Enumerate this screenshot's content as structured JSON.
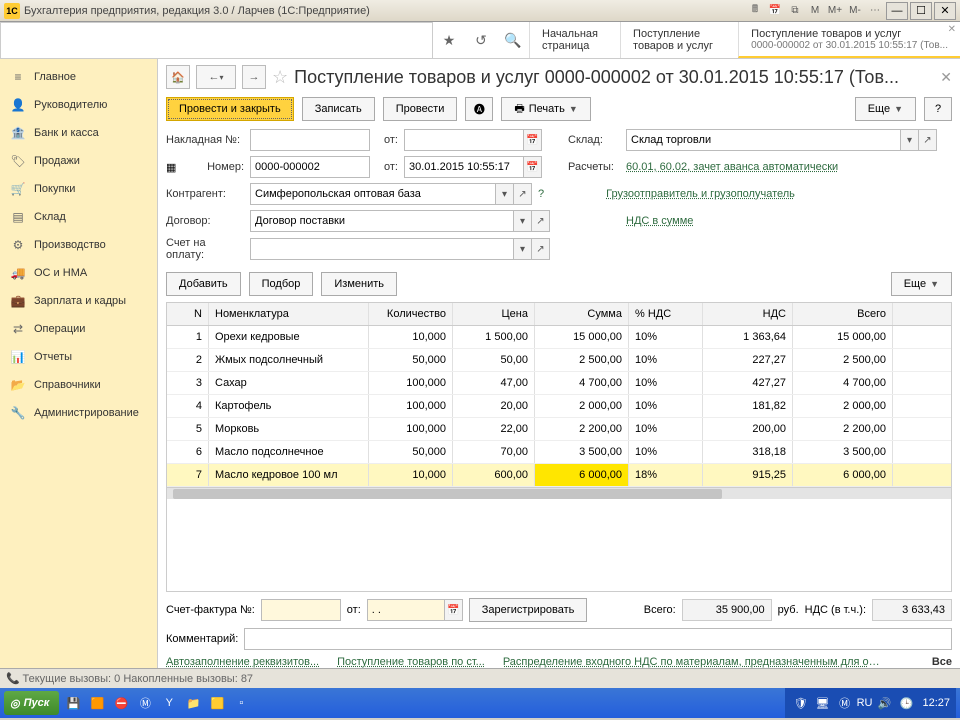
{
  "titlebar": {
    "app_icon": "1C",
    "title": "Бухгалтерия предприятия, редакция 3.0 / Ларчев  (1С:Предприятие)"
  },
  "tabs": {
    "t0": "Начальная страница",
    "t1": "Поступление товаров и услуг",
    "t2": "Поступление товаров и услуг",
    "t2_sub": "0000-000002 от 30.01.2015 10:55:17 (Тов..."
  },
  "sidebar": {
    "items": [
      {
        "icon": "≡",
        "label": "Главное"
      },
      {
        "icon": "👤",
        "label": "Руководителю"
      },
      {
        "icon": "🏦",
        "label": "Банк и касса"
      },
      {
        "icon": "🏷",
        "label": "Продажи"
      },
      {
        "icon": "🛒",
        "label": "Покупки"
      },
      {
        "icon": "▤",
        "label": "Склад"
      },
      {
        "icon": "⚙",
        "label": "Производство"
      },
      {
        "icon": "🚚",
        "label": "ОС и НМА"
      },
      {
        "icon": "💼",
        "label": "Зарплата и кадры"
      },
      {
        "icon": "⇄",
        "label": "Операции"
      },
      {
        "icon": "📊",
        "label": "Отчеты"
      },
      {
        "icon": "📂",
        "label": "Справочники"
      },
      {
        "icon": "🔧",
        "label": "Администрирование"
      }
    ]
  },
  "header": {
    "title": "Поступление товаров и услуг 0000-000002 от 30.01.2015 10:55:17 (Тов..."
  },
  "toolbar": {
    "post_close": "Провести и закрыть",
    "write": "Записать",
    "post": "Провести",
    "print": "Печать",
    "more": "Еще"
  },
  "form": {
    "nakl_label": "Накладная №:",
    "ot": "от:",
    "sklad_label": "Склад:",
    "sklad_value": "Склад торговли",
    "nomer_label": "Номер:",
    "nomer_value": "0000-000002",
    "nomer_date": "30.01.2015 10:55:17",
    "raschety_label": "Расчеты:",
    "raschety_link": "60.01, 60.02, зачет аванса автоматически",
    "kontragent_label": "Контрагент:",
    "kontragent_value": "Симферопольская оптовая база",
    "gruz_link": "Грузоотправитель и грузополучатель",
    "dogovor_label": "Договор:",
    "dogovor_value": "Договор поставки",
    "nds_link": "НДС в сумме",
    "schet_oplata_label": "Счет на оплату:"
  },
  "table_toolbar": {
    "add": "Добавить",
    "select": "Подбор",
    "change": "Изменить",
    "more": "Еще"
  },
  "grid": {
    "cols": {
      "n": "N",
      "nom": "Номенклатура",
      "qty": "Количество",
      "price": "Цена",
      "sum": "Сумма",
      "vat": "% НДС",
      "vatv": "НДС",
      "total": "Всего"
    },
    "rows": [
      {
        "n": "1",
        "nom": "Орехи кедровые",
        "qty": "10,000",
        "price": "1 500,00",
        "sum": "15 000,00",
        "vat": "10%",
        "vatv": "1 363,64",
        "total": "15 000,00"
      },
      {
        "n": "2",
        "nom": "Жмых подсолнечный",
        "qty": "50,000",
        "price": "50,00",
        "sum": "2 500,00",
        "vat": "10%",
        "vatv": "227,27",
        "total": "2 500,00"
      },
      {
        "n": "3",
        "nom": "Сахар",
        "qty": "100,000",
        "price": "47,00",
        "sum": "4 700,00",
        "vat": "10%",
        "vatv": "427,27",
        "total": "4 700,00"
      },
      {
        "n": "4",
        "nom": "Картофель",
        "qty": "100,000",
        "price": "20,00",
        "sum": "2 000,00",
        "vat": "10%",
        "vatv": "181,82",
        "total": "2 000,00"
      },
      {
        "n": "5",
        "nom": "Морковь",
        "qty": "100,000",
        "price": "22,00",
        "sum": "2 200,00",
        "vat": "10%",
        "vatv": "200,00",
        "total": "2 200,00"
      },
      {
        "n": "6",
        "nom": "Масло подсолнечное",
        "qty": "50,000",
        "price": "70,00",
        "sum": "3 500,00",
        "vat": "10%",
        "vatv": "318,18",
        "total": "3 500,00"
      },
      {
        "n": "7",
        "nom": "Масло кедровое 100 мл",
        "qty": "10,000",
        "price": "600,00",
        "sum": "6 000,00",
        "vat": "18%",
        "vatv": "915,25",
        "total": "6 000,00"
      }
    ]
  },
  "footer": {
    "sf_label": "Счет-фактура №:",
    "ot": "от:",
    "date_stub": ". .",
    "register": "Зарегистрировать",
    "total_label": "Всего:",
    "total_value": "35 900,00",
    "rub": "руб.",
    "vat_incl_label": "НДС (в т.ч.):",
    "vat_incl_value": "3 633,43",
    "comment_label": "Комментарий:"
  },
  "links": {
    "l1": "Автозаполнение реквизитов...",
    "l2": "Поступление товаров по ст...",
    "l3": "Распределение входного НДС по материалам, предназначенным для облаг...",
    "all": "Все"
  },
  "statusbar": {
    "text": "Текущие вызовы: 0  Накопленные вызовы: 87"
  },
  "taskbar": {
    "start": "Пуск",
    "lang": "RU",
    "clock": "12:27"
  }
}
